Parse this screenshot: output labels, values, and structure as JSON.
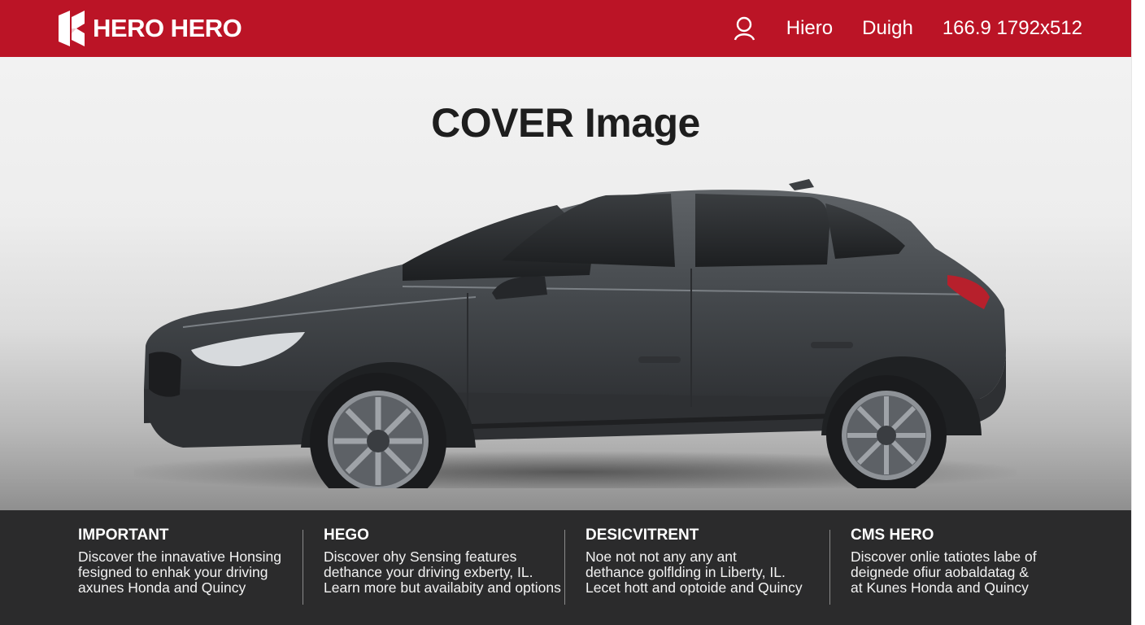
{
  "header": {
    "brand_name": "HERO HERO",
    "nav_links": [
      "Hiero",
      "Duigh"
    ],
    "meta": "166.9 1792x512",
    "search_icon": "search-icon",
    "background_color": "#bb1426"
  },
  "hero": {
    "title": "COVER Image",
    "image": "dark-gray-hatchback-car"
  },
  "features": [
    {
      "title": "IMPORTANT",
      "lines": [
        "Discover the innavative Honsing",
        "fesigned to enhak your driving",
        "axunes Honda and Quincy"
      ]
    },
    {
      "title": "HEGO",
      "lines": [
        "Discover ohy Sensing features",
        "dethance your driving exberty, IL.",
        "Learn more but availabity and options"
      ]
    },
    {
      "title": "DESICVITRENT",
      "lines": [
        "Noe not not any any ant",
        "dethance golflding in Liberty, IL.",
        "Lecet hott and optoide and Quincy"
      ]
    },
    {
      "title": "CMS HERO",
      "lines": [
        "Discover onlie tatiotes labe of",
        "deignede ofiur aobaldatag &",
        "at Kunes Honda and Quincy"
      ]
    }
  ]
}
